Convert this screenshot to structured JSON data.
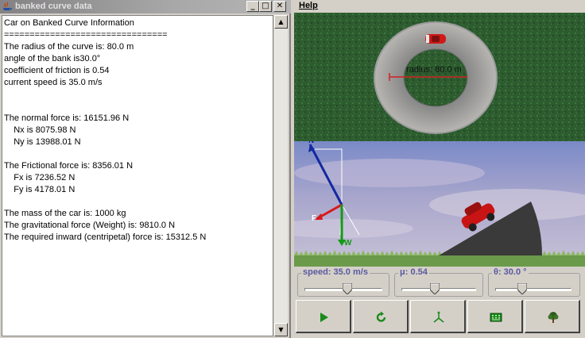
{
  "data_window": {
    "title": "banked curve data",
    "controls": {
      "minimize": "_",
      "maximize": "□",
      "close": "✕"
    },
    "lines": [
      "Car on Banked Curve Information",
      "================================",
      "The radius of the curve is: 80.0 m",
      "angle of the bank is30.0°",
      "coefficient of friction is 0.54",
      "current speed is 35.0 m/s",
      "",
      "",
      "The normal force is: 16151.96 N",
      "    Nx is 8075.98 N",
      "    Ny is 13988.01 N",
      "",
      "The Frictional force is: 8356.01 N",
      "    Fx is 7236.52 N",
      "    Fy is 4178.01 N",
      "",
      "The mass of the car is: 1000 kg",
      "The gravitational force (Weight) is: 9810.0 N",
      "The required inward (centripetal) force is: 15312.5 N"
    ]
  },
  "sim_window": {
    "menu": {
      "help": "Help"
    },
    "top_view": {
      "radius_label": "radius: 80.0 m"
    },
    "vectors": {
      "n_label": "N",
      "f_label": "F",
      "w_label": "W"
    },
    "sliders": {
      "speed": {
        "label": "speed: 35.0 m/s",
        "level": 0.55
      },
      "mu": {
        "label": "μ: 0.54",
        "level": 0.45
      },
      "theta": {
        "label": "θ: 30.0 °",
        "level": 0.35
      }
    },
    "buttons": [
      {
        "name": "play-button",
        "icon": "play-icon",
        "color": "#1a8a1a"
      },
      {
        "name": "reset-button",
        "icon": "reset-icon",
        "color": "#1a8a1a"
      },
      {
        "name": "vectors-button",
        "icon": "vectors-icon",
        "color": "#1a8a1a"
      },
      {
        "name": "calculator-button",
        "icon": "calculator-icon",
        "color": "#1a8a1a"
      },
      {
        "name": "tree-button",
        "icon": "tree-icon",
        "color": "#2e5a1e"
      }
    ]
  }
}
